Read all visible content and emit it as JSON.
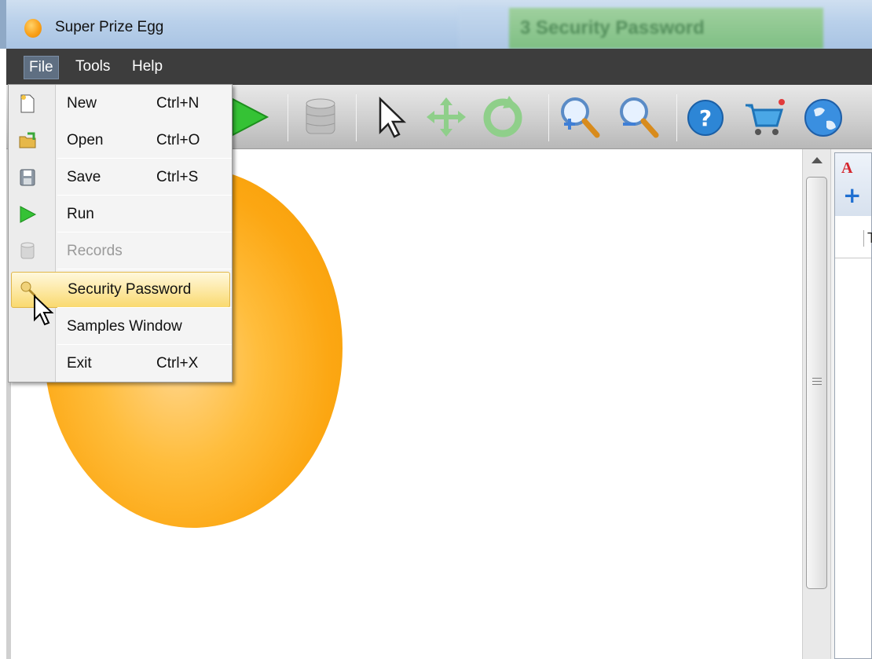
{
  "window": {
    "title": "Super Prize Egg",
    "background_window_title": "3 Security Password"
  },
  "menubar": {
    "items": [
      {
        "label": "File",
        "active": true
      },
      {
        "label": "Tools",
        "active": false
      },
      {
        "label": "Help",
        "active": false
      }
    ]
  },
  "toolbar": {
    "buttons": [
      "run-icon",
      "records-icon",
      "pointer-icon",
      "move-icon",
      "rotate-icon",
      "zoom-in-icon",
      "zoom-out-icon",
      "help-icon",
      "cart-icon",
      "globe-icon"
    ]
  },
  "file_menu": {
    "items": [
      {
        "label": "New",
        "shortcut": "Ctrl+N",
        "icon": "new-file-icon",
        "enabled": true
      },
      {
        "label": "Open",
        "shortcut": "Ctrl+O",
        "icon": "open-folder-icon",
        "enabled": true
      },
      {
        "label": "Save",
        "shortcut": "Ctrl+S",
        "icon": "save-icon",
        "enabled": true
      },
      {
        "label": "Run",
        "shortcut": "",
        "icon": "run-icon",
        "enabled": true
      },
      {
        "label": "Records",
        "shortcut": "",
        "icon": "records-icon",
        "enabled": false
      },
      {
        "label": "Security Password",
        "shortcut": "",
        "icon": "security-key-icon",
        "enabled": true,
        "highlighted": true
      },
      {
        "label": "Samples Window",
        "shortcut": "",
        "icon": "",
        "enabled": true
      },
      {
        "label": "Exit",
        "shortcut": "Ctrl+X",
        "icon": "",
        "enabled": true
      }
    ]
  },
  "right_panel": {
    "font_icon_text": "A",
    "column_header": "T"
  },
  "colors": {
    "egg": "#fca713",
    "menubar": "#3d3d3d",
    "highlight": "#fde9a6",
    "run_green": "#2dbb2d"
  }
}
